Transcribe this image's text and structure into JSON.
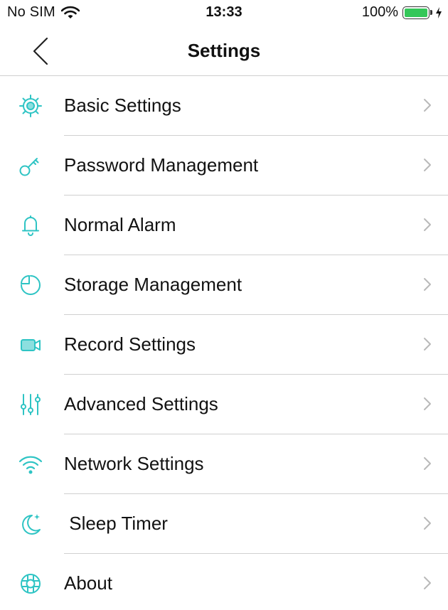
{
  "status_bar": {
    "carrier": "No SIM",
    "time": "13:33",
    "battery": "100%",
    "battery_color": "#34c759"
  },
  "nav": {
    "title": "Settings",
    "back_icon": "chevron-left-icon"
  },
  "accent_color": "#2ec4c4",
  "items": [
    {
      "label": "Basic Settings",
      "icon": "gear-icon"
    },
    {
      "label": "Password Management",
      "icon": "key-icon"
    },
    {
      "label": "Normal Alarm",
      "icon": "bell-icon"
    },
    {
      "label": "Storage Management",
      "icon": "pie-chart-icon"
    },
    {
      "label": "Record Settings",
      "icon": "video-camera-icon"
    },
    {
      "label": "Advanced Settings",
      "icon": "sliders-icon"
    },
    {
      "label": "Network Settings",
      "icon": "wifi-icon"
    },
    {
      "label": " Sleep Timer",
      "icon": "moon-icon"
    },
    {
      "label": "About",
      "icon": "lifebuoy-icon"
    }
  ]
}
